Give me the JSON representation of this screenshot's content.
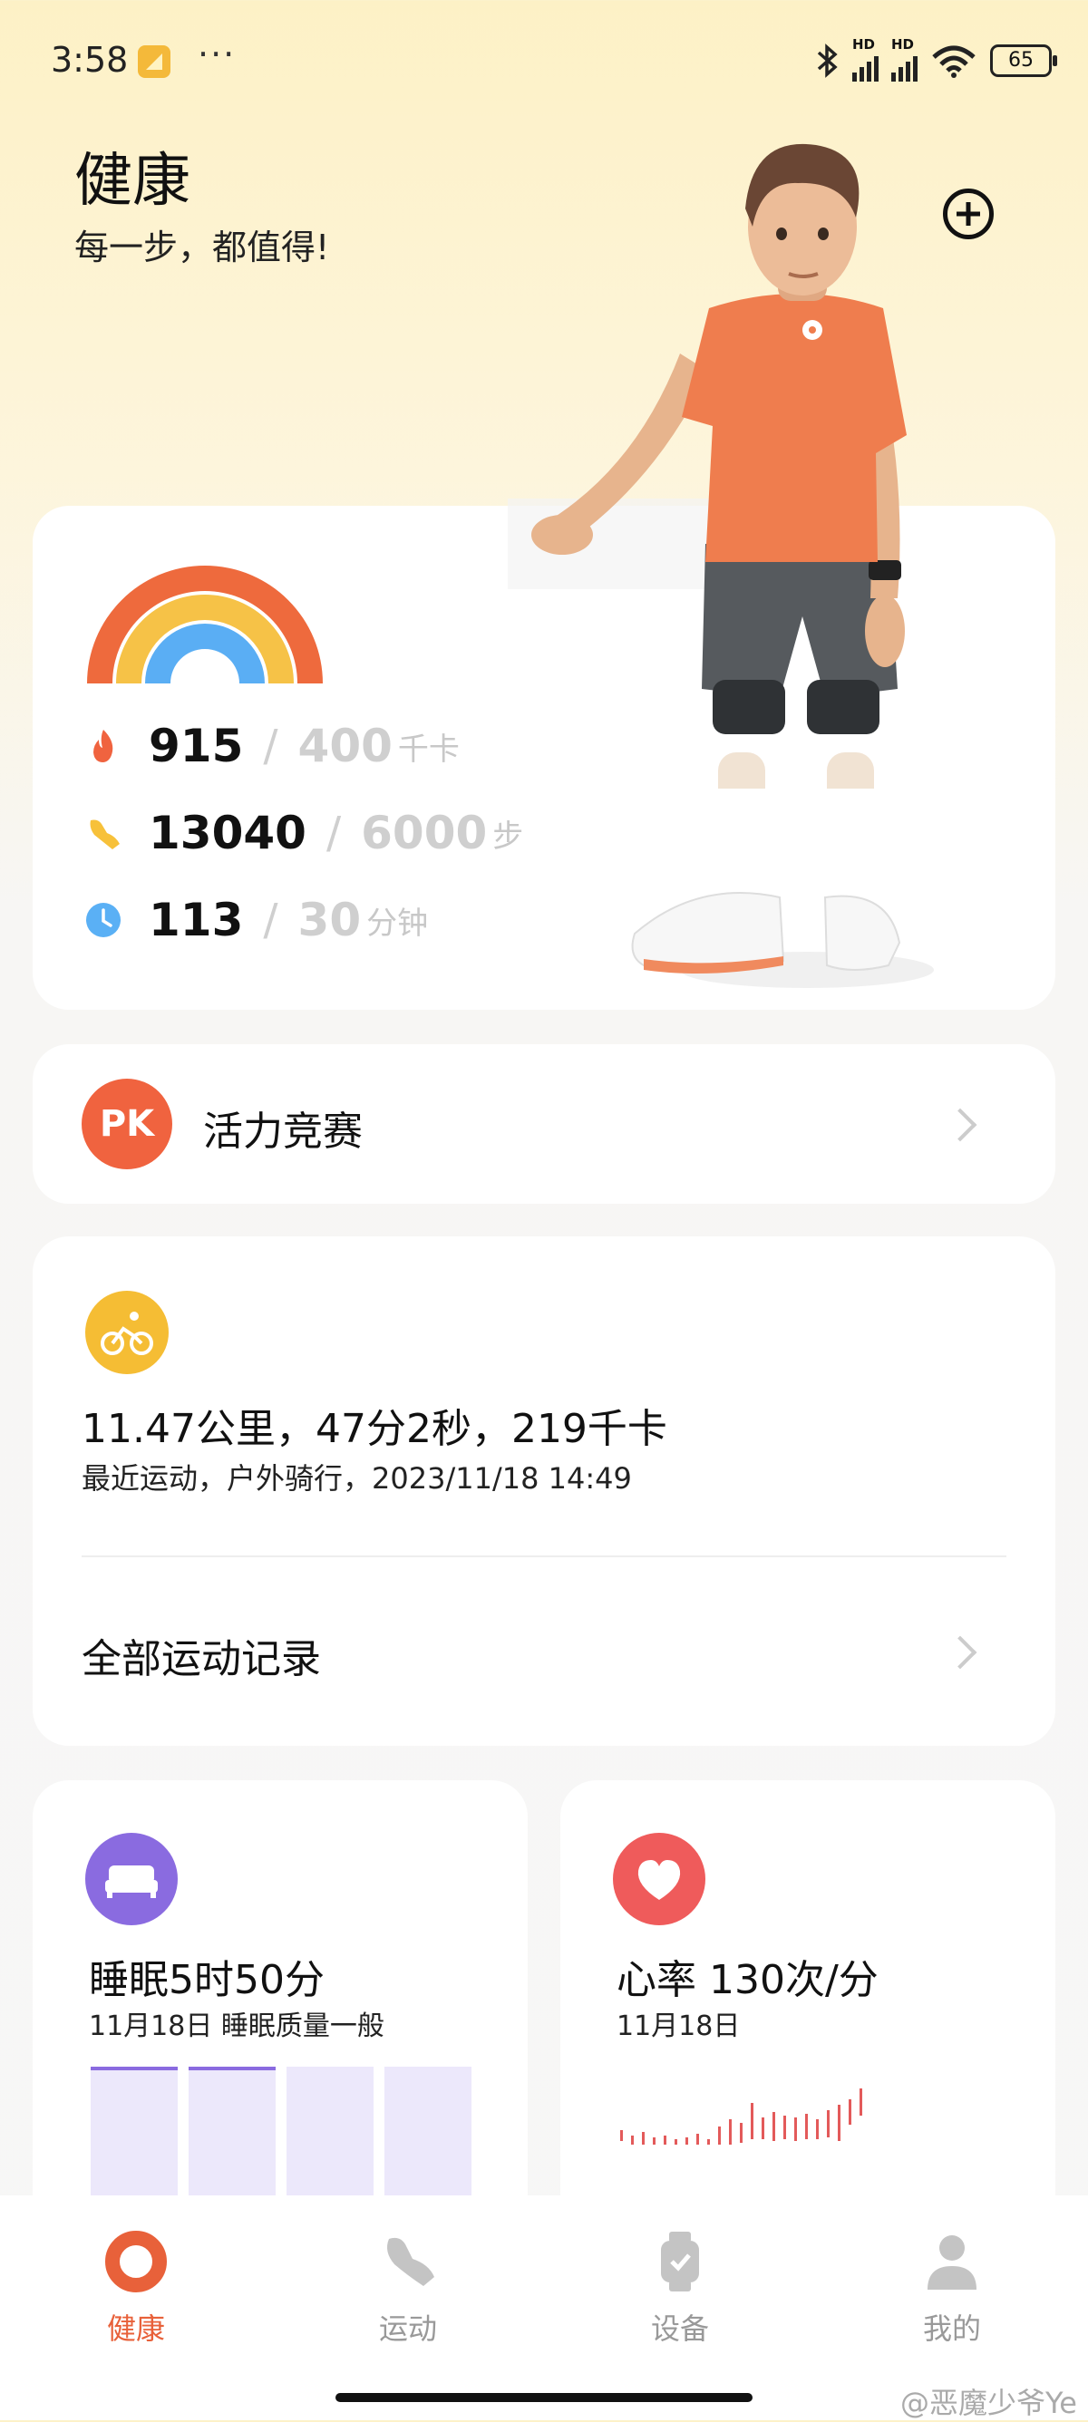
{
  "status_bar": {
    "time": "3:58",
    "dots": "···",
    "battery": "65",
    "signal_label": "HD"
  },
  "header": {
    "title": "健康",
    "subtitle": "每一步，都值得!"
  },
  "activity": {
    "calories": {
      "value": "915",
      "sep": "/",
      "goal": "400",
      "unit": "千卡",
      "color": "#f0633f"
    },
    "steps": {
      "value": "13040",
      "sep": "/",
      "goal": "6000",
      "unit": "步",
      "color": "#f7c13a"
    },
    "minutes": {
      "value": "113",
      "sep": "/",
      "goal": "30",
      "unit": "分钟",
      "color": "#5ab0f5"
    }
  },
  "pk": {
    "badge": "PK",
    "label": "活力竞赛"
  },
  "workout": {
    "summary": "11.47公里，47分2秒，219千卡",
    "detail": "最近运动，户外骑行，2023/11/18 14:49",
    "all_records": "全部运动记录"
  },
  "sleep": {
    "title": "睡眠5时50分",
    "subtitle": "11月18日  睡眠质量一般",
    "bar_levels": [
      1,
      1,
      1,
      1
    ]
  },
  "heart": {
    "title": "心率 130次/分",
    "subtitle": "11月18日"
  },
  "nav": {
    "items": [
      {
        "label": "健康",
        "active": true
      },
      {
        "label": "运动",
        "active": false
      },
      {
        "label": "设备",
        "active": false
      },
      {
        "label": "我的",
        "active": false
      }
    ]
  },
  "watermark": "@恶魔少爷Ye"
}
